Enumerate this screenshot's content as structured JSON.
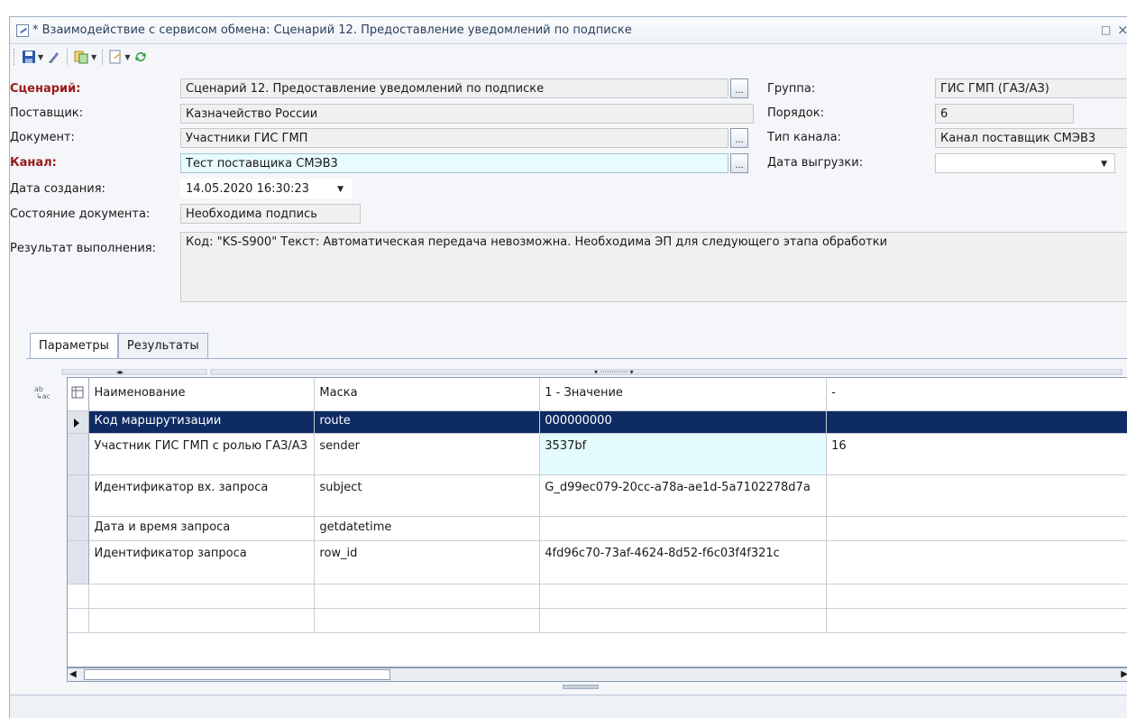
{
  "window": {
    "title": "* Взаимодействие с сервисом обмена: Сценарий 12. Предоставление уведомлений по подписке",
    "restore_glyph": "□",
    "close_glyph": "×"
  },
  "toolbar": {
    "icons": [
      "save-icon",
      "edit-icon",
      "copy-icon",
      "document-icon",
      "refresh-icon"
    ]
  },
  "form": {
    "scenario_label": "Сценарий:",
    "scenario_value": "Сценарий 12. Предоставление уведомлений по подписке",
    "supplier_label": "Поставщик:",
    "supplier_value": "Казначейство России",
    "document_label": "Документ:",
    "document_value": "Участники ГИС ГМП",
    "channel_label": "Канал:",
    "channel_value": "Тест поставщика СМЭВ3",
    "created_label": "Дата создания:",
    "created_value": "14.05.2020 16:30:23",
    "state_label": "Состояние документа:",
    "state_value": "Необходима подпись",
    "result_label": "Результат выполнения:",
    "result_value": "Код: \"KS-S900\" Текст: Автоматическая передача невозможна. Необходима ЭП для следующего этапа обработки",
    "group_label": "Группа:",
    "group_value": "ГИС ГМП (ГАЗ/АЗ)",
    "order_label": "Порядок:",
    "order_value": "6",
    "channel_type_label": "Тип канала:",
    "channel_type_value": "Канал поставщик СМЭВ3",
    "export_date_label": "Дата выгрузки:",
    "export_date_value": "",
    "ellipsis": "..."
  },
  "tabs": [
    {
      "label": "Параметры",
      "active": true
    },
    {
      "label": "Результаты",
      "active": false
    }
  ],
  "grid": {
    "columns": [
      "Наименование",
      "Маска",
      "1 - Значение",
      "-"
    ],
    "rows": [
      {
        "name": "Код маршрутизации",
        "mask": "route",
        "value": "000000000",
        "extra": ""
      },
      {
        "name": "Участник ГИС ГМП с ролью ГАЗ/АЗ",
        "mask": "sender",
        "value": "3537bf",
        "extra": "16"
      },
      {
        "name": "Идентификатор вх. запроса",
        "mask": "subject",
        "value": "G_d99ec079-20cc-a78a-ae1d-5a7102278d7a",
        "extra": ""
      },
      {
        "name": "Дата и время запроса",
        "mask": "getdatetime",
        "value": "",
        "extra": ""
      },
      {
        "name": "Идентификатор запроса",
        "mask": "row_id",
        "value": "4fd96c70-73af-4624-8d52-f6c03f4f321c",
        "extra": ""
      }
    ]
  },
  "colors": {
    "selected_row": "#0f2b63",
    "required_label": "#9a1a1a",
    "highlight_field": "#e8fbff"
  }
}
